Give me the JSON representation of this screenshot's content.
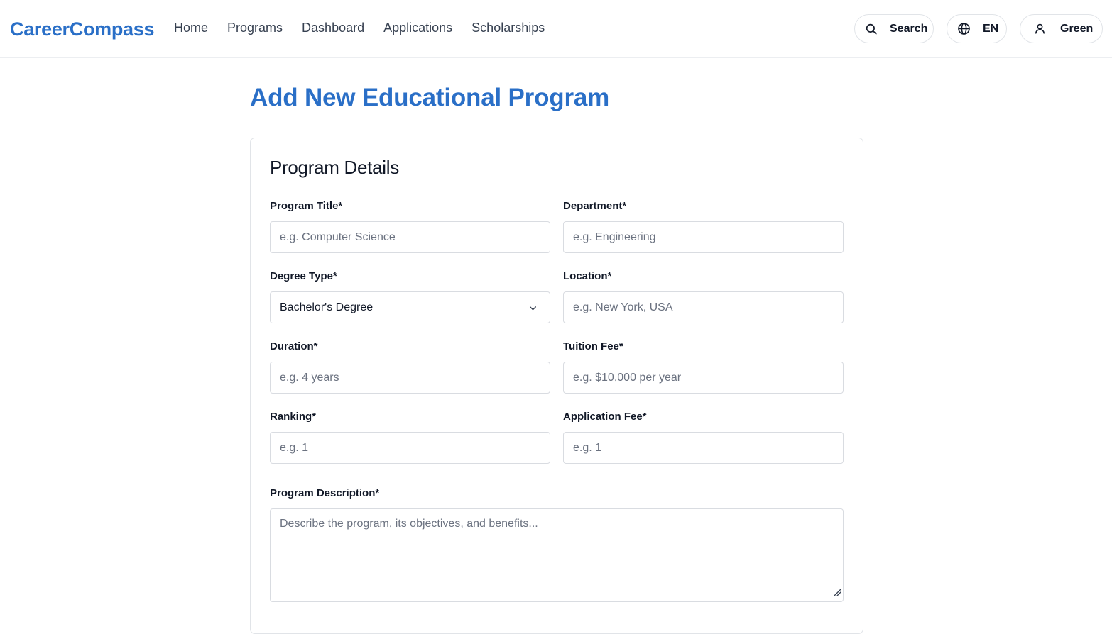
{
  "header": {
    "logo": "CareerCompass",
    "nav": [
      "Home",
      "Programs",
      "Dashboard",
      "Applications",
      "Scholarships"
    ],
    "search_label": "Search",
    "language_label": "EN",
    "user_label": "Green",
    "icons": {
      "search": "search-icon",
      "language": "globe-icon",
      "user": "user-icon"
    }
  },
  "page": {
    "title": "Add New Educational Program"
  },
  "form": {
    "section_title": "Program Details",
    "program_title": {
      "label": "Program Title*",
      "placeholder": "e.g. Computer Science",
      "value": ""
    },
    "department": {
      "label": "Department*",
      "placeholder": "e.g. Engineering",
      "value": ""
    },
    "degree_type": {
      "label": "Degree Type*",
      "selected": "Bachelor's Degree"
    },
    "location": {
      "label": "Location*",
      "placeholder": "e.g. New York, USA",
      "value": ""
    },
    "duration": {
      "label": "Duration*",
      "placeholder": "e.g. 4 years",
      "value": ""
    },
    "tuition_fee": {
      "label": "Tuition Fee*",
      "placeholder": "e.g. $10,000 per year",
      "value": ""
    },
    "ranking": {
      "label": "Ranking*",
      "placeholder": "e.g. 1",
      "value": ""
    },
    "application_fee": {
      "label": "Application Fee*",
      "placeholder": "e.g. 1",
      "value": ""
    },
    "description": {
      "label": "Program Description*",
      "placeholder": "Describe the program, its objectives, and benefits...",
      "value": ""
    }
  },
  "colors": {
    "brand": "#2a6fc7",
    "border": "#d9dce1",
    "text": "#111827",
    "muted": "#6b7280"
  }
}
